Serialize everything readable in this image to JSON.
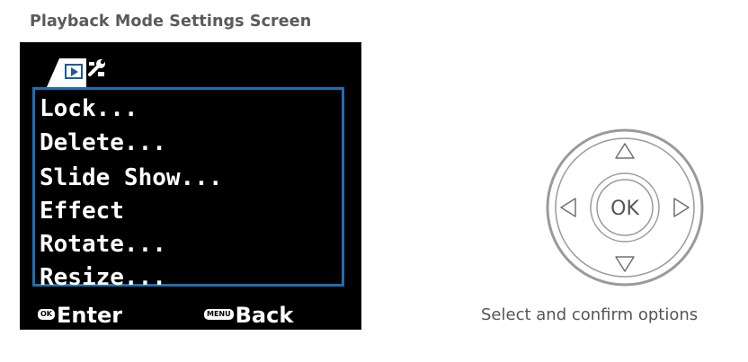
{
  "page": {
    "title": "Playback Mode Settings Screen"
  },
  "screen": {
    "tabs": [
      {
        "icon": "playback-icon",
        "selected": true
      },
      {
        "icon": "wrench-icon",
        "selected": false
      }
    ],
    "menu_items": [
      "Lock...",
      "Delete...",
      "Slide Show...",
      "Effect",
      "Rotate...",
      "Resize..."
    ],
    "footer": {
      "ok_badge": "OK",
      "enter_label": "Enter",
      "menu_badge": "MENU",
      "back_label": "Back"
    },
    "colors": {
      "accent": "#1f6fb3",
      "background": "#000000",
      "text": "#ffffff"
    }
  },
  "controller": {
    "center_label": "OK",
    "directions": [
      "up",
      "down",
      "left",
      "right"
    ],
    "caption": "Select and confirm options"
  }
}
